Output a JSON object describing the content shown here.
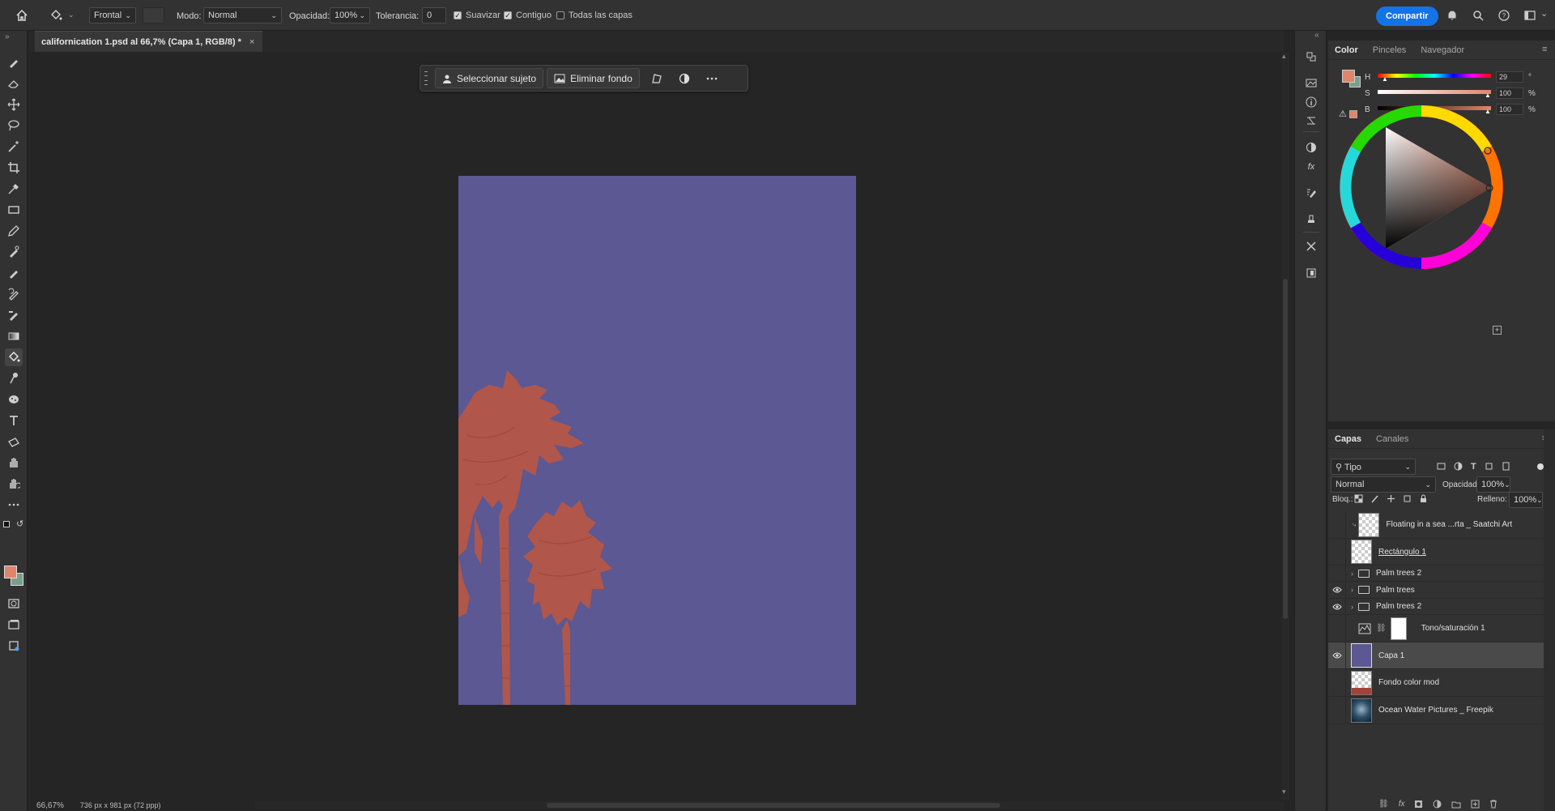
{
  "options_bar": {
    "preset": "Frontal",
    "mode_label": "Modo:",
    "mode_value": "Normal",
    "opacity_label": "Opacidad:",
    "opacity_value": "100%",
    "tolerance_label": "Tolerancia:",
    "tolerance_value": "0",
    "smooth_label": "Suavizar",
    "contiguous_label": "Contiguo",
    "all_layers_label": "Todas las capas",
    "share_label": "Compartir"
  },
  "document": {
    "tab_title": "californication 1.psd al 66,7% (Capa 1, RGB/8) *",
    "background_color": "#5b5893",
    "palm_color": "#b1564a"
  },
  "context_bar": {
    "select_subject": "Seleccionar sujeto",
    "remove_background": "Eliminar fondo"
  },
  "status": {
    "zoom": "66,67%",
    "doc_info": "736 px x 981 px (72 ppp)"
  },
  "color_panel": {
    "tabs": [
      "Color",
      "Pinceles",
      "Navegador"
    ],
    "h_label": "H",
    "s_label": "S",
    "b_label": "B",
    "h_value": "29",
    "s_value": "100",
    "b_value": "100",
    "h_unit": "°",
    "s_unit": "%",
    "b_unit": "%",
    "foreground": "#e0856b",
    "background": "#7a9e8e"
  },
  "layers_panel": {
    "tabs": [
      "Capas",
      "Canales"
    ],
    "filter_value": "Tipo",
    "blend_mode": "Normal",
    "opacity_label": "Opacidad:",
    "opacity_value": "100%",
    "lock_label": "Bloq.:",
    "fill_label": "Relleno:",
    "fill_value": "100%",
    "layers": [
      {
        "name": "Floating in a sea ...rta _ Saatchi Art",
        "visible": false,
        "kind": "smart"
      },
      {
        "name": "Rectángulo 1",
        "visible": false,
        "kind": "shape"
      },
      {
        "name": "Palm trees 2",
        "visible": false,
        "kind": "group"
      },
      {
        "name": "Palm trees",
        "visible": true,
        "kind": "group"
      },
      {
        "name": "Palm trees 2",
        "visible": true,
        "kind": "group"
      },
      {
        "name": "Tono/saturación 1",
        "visible": false,
        "kind": "adjustment"
      },
      {
        "name": "Capa 1",
        "visible": true,
        "kind": "pixel",
        "selected": true
      },
      {
        "name": "Fondo color mod",
        "visible": false,
        "kind": "pixel"
      },
      {
        "name": "Ocean Water Pictures _ Freepik",
        "visible": false,
        "kind": "pixel"
      }
    ]
  }
}
